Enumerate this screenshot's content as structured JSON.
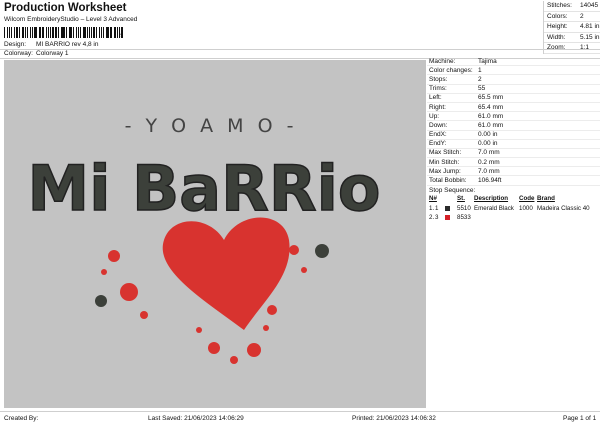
{
  "header": {
    "title": "Production Worksheet",
    "subtitle": "Wilcom EmbroideryStudio – Level 3 Advanced",
    "barcode_tail": ","
  },
  "meta": [
    {
      "key": "Design:",
      "value": "MI BARRIO rev 4,8 in"
    },
    {
      "key": "Colorway:",
      "value": "Colorway 1"
    }
  ],
  "stats": [
    {
      "key": "Stitches:",
      "value": "14045"
    },
    {
      "key": "Colors:",
      "value": "2"
    },
    {
      "key": "Height:",
      "value": "4.81 in"
    },
    {
      "key": "Width:",
      "value": "5.15 in"
    },
    {
      "key": "Zoom:",
      "value": "1:1"
    }
  ],
  "info": [
    {
      "key": "Machine:",
      "value": "Tajima"
    },
    {
      "key": "Color changes:",
      "value": "1"
    },
    {
      "key": "Stops:",
      "value": "2"
    },
    {
      "key": "Trims:",
      "value": "55"
    },
    {
      "key": "Left:",
      "value": "65.5 mm"
    },
    {
      "key": "Right:",
      "value": "65.4 mm"
    },
    {
      "key": "Up:",
      "value": "61.0 mm"
    },
    {
      "key": "Down:",
      "value": "61.0 mm"
    },
    {
      "key": "EndX:",
      "value": "0.00 in"
    },
    {
      "key": "EndY:",
      "value": "0.00 in"
    },
    {
      "key": "Max Stitch:",
      "value": "7.0 mm"
    },
    {
      "key": "Min Stitch:",
      "value": "0.2 mm"
    },
    {
      "key": "Max Jump:",
      "value": "7.0 mm"
    },
    {
      "key": "Total Bobbin:",
      "value": "106.94ft"
    }
  ],
  "stop_sequence": {
    "label": "Stop Sequence:",
    "columns": {
      "n": "N#",
      "st": "St.",
      "description": "Description",
      "code": "Code",
      "brand": "Brand"
    },
    "rows": [
      {
        "index": "1.",
        "stop": "1",
        "color": "#2b2b2b",
        "stitches": "5510",
        "description": "Emerald Black",
        "code": "1000",
        "brand": "Madeira Classic 40"
      },
      {
        "index": "2.",
        "stop": "3",
        "color": "#d42027",
        "stitches": "8533",
        "description": "",
        "code": "",
        "brand": ""
      }
    ]
  },
  "design_preview": {
    "top_text": "- Y O A M O -",
    "main_text": "Mi BaRRio",
    "text_color": "#3c403a",
    "heart_color": "#d8332f",
    "background": "#c3c3c3"
  },
  "footer": {
    "created_by": "Created By:",
    "last_saved": "Last Saved: 21/06/2023 14:06:29",
    "printed": "Printed: 21/06/2023 14:06:32",
    "page": "Page 1 of 1"
  }
}
